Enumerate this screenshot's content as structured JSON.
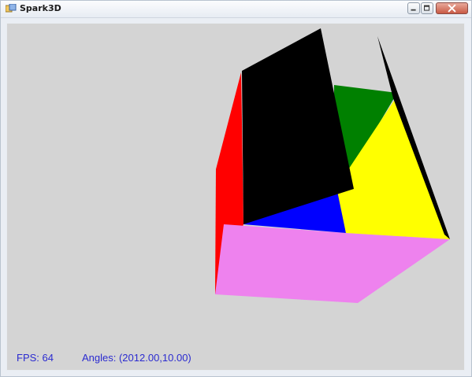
{
  "window": {
    "title": "Spark3D",
    "app_icon": "app-icon"
  },
  "caption_buttons": {
    "minimize_icon": "minimize-icon",
    "maximize_icon": "maximize-icon",
    "close_icon": "close-icon"
  },
  "scene": {
    "background": "#d4d4d4",
    "face_colors": {
      "left": "#ff0000",
      "front_bottom": "#ee82ee",
      "inner_back": "#008000",
      "inner_floor": "#0000ff",
      "right": "#ffff00",
      "lid": "#000000",
      "right_flap": "#000000"
    }
  },
  "status": {
    "fps": "FPS: 64",
    "angles": "Angles: (2012.00,10.00)",
    "color": "#2b2bd0"
  }
}
